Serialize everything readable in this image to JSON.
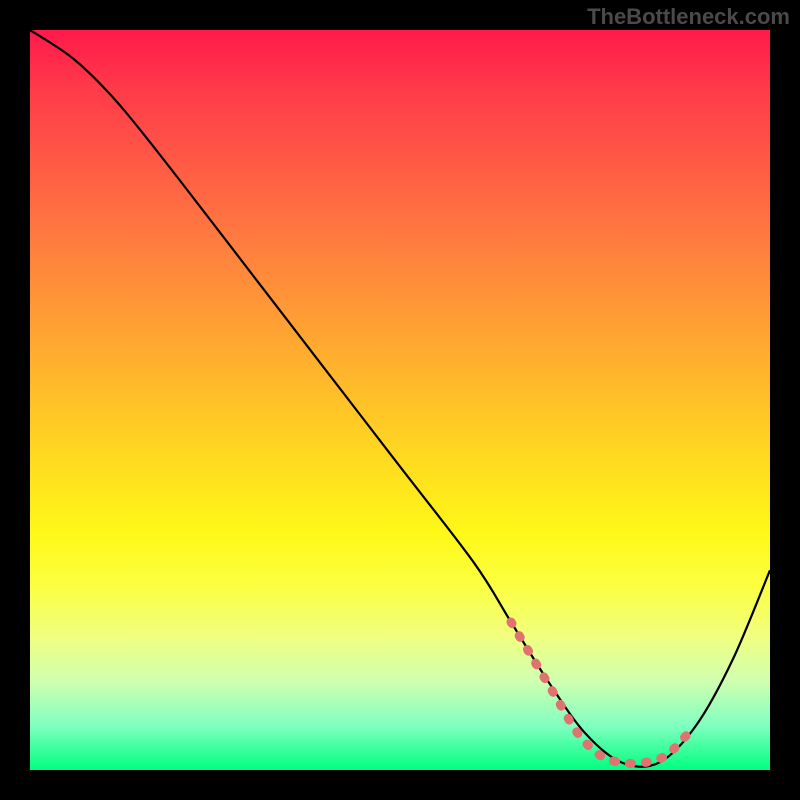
{
  "watermark": "TheBottleneck.com",
  "chart_data": {
    "type": "line",
    "title": "",
    "xlabel": "",
    "ylabel": "",
    "xlim": [
      0,
      100
    ],
    "ylim": [
      0,
      100
    ],
    "series": [
      {
        "name": "main-curve",
        "color": "#000000",
        "x": [
          0,
          6,
          12,
          20,
          30,
          40,
          50,
          60,
          65,
          70,
          75,
          80,
          85,
          90,
          95,
          100
        ],
        "y": [
          100,
          96,
          90,
          80,
          67,
          54,
          41,
          28,
          20,
          12,
          5,
          1,
          1,
          6,
          15,
          27
        ]
      },
      {
        "name": "highlight-segment",
        "color": "#e0736f",
        "x": [
          65,
          68,
          71,
          74,
          77,
          80,
          83,
          86,
          89
        ],
        "y": [
          20,
          15,
          10,
          5,
          2,
          1,
          1,
          2,
          5
        ]
      }
    ],
    "gradient_stops": [
      {
        "pos": 0,
        "color": "#ff1a4a"
      },
      {
        "pos": 50,
        "color": "#ffda20"
      },
      {
        "pos": 100,
        "color": "#00ff80"
      }
    ]
  }
}
